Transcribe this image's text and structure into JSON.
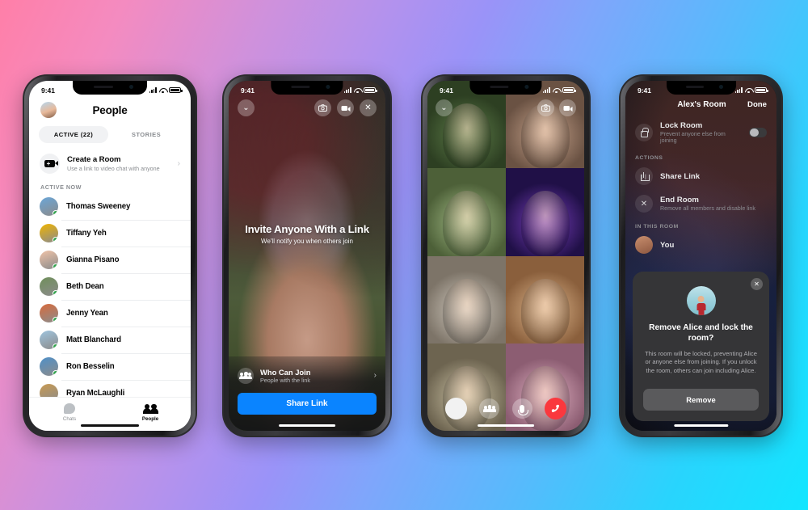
{
  "background": {
    "from": "#ff7fa8",
    "mid": "#9a93f8",
    "to": "#12e6ff"
  },
  "status_bar": {
    "time": "9:41"
  },
  "phone1": {
    "title": "People",
    "tabs": [
      {
        "label": "ACTIVE (22)",
        "active": true
      },
      {
        "label": "STORIES",
        "active": false
      }
    ],
    "create_room": {
      "title": "Create a Room",
      "subtitle": "Use a link to video chat with anyone",
      "chevron": "›"
    },
    "section_label": "ACTIVE NOW",
    "contacts": [
      {
        "name": "Thomas Sweeney",
        "color": "#6aa6d8"
      },
      {
        "name": "Tiffany Yeh",
        "color": "#f0b400"
      },
      {
        "name": "Gianna Pisano",
        "color": "#f0c3a8"
      },
      {
        "name": "Beth Dean",
        "color": "#6f8f5a"
      },
      {
        "name": "Jenny Yean",
        "color": "#d86a3c"
      },
      {
        "name": "Matt Blanchard",
        "color": "#9fc4de"
      },
      {
        "name": "Ron Besselin",
        "color": "#4f90c8"
      },
      {
        "name": "Ryan McLaughli",
        "color": "#c89a52"
      }
    ],
    "tabbar": [
      {
        "label": "Chats",
        "icon": "chat-bubble-icon",
        "active": false
      },
      {
        "label": "People",
        "icon": "people-icon",
        "active": true
      }
    ]
  },
  "phone2": {
    "controls": {
      "collapse": "chevron-down-icon",
      "flip_camera": "flip-camera-icon",
      "video": "video-camera-icon",
      "close": "✕"
    },
    "hero_title": "Invite Anyone With a Link",
    "hero_subtitle": "We'll notify you when others join",
    "who_can_join": {
      "title": "Who Can Join",
      "subtitle": "People with the link",
      "chevron": "›"
    },
    "share_button": "Share Link",
    "accent": "#0a84ff"
  },
  "phone3": {
    "controls": {
      "collapse": "chevron-down-icon",
      "flip_camera": "flip-camera-icon",
      "video": "video-camera-icon"
    },
    "call_controls": [
      {
        "name": "shutter-button",
        "icon": "shutter-icon"
      },
      {
        "name": "participants-button",
        "icon": "people-icon"
      },
      {
        "name": "mute-button",
        "icon": "microphone-icon"
      },
      {
        "name": "end-call-button",
        "icon": "phone-hangup-icon",
        "color": "#fa383e"
      }
    ],
    "tiles": [
      {
        "label": "participant-1",
        "bg_from": "#5f7f4a",
        "bg_to": "#2d3f22"
      },
      {
        "label": "participant-2",
        "bg_from": "#c8a48c",
        "bg_to": "#6a5243"
      },
      {
        "label": "participant-3",
        "bg_from": "#a7c08a",
        "bg_to": "#4d6038"
      },
      {
        "label": "participant-4",
        "bg_from": "#7b3fbf",
        "bg_to": "#201047"
      },
      {
        "label": "participant-5",
        "bg_from": "#d6cfc4",
        "bg_to": "#7d7468"
      },
      {
        "label": "participant-6",
        "bg_from": "#e0b98f",
        "bg_to": "#8a5f3c"
      },
      {
        "label": "participant-7",
        "bg_from": "#cfc6a8",
        "bg_to": "#6d6450"
      },
      {
        "label": "participant-8",
        "bg_from": "#e3b3c4",
        "bg_to": "#8c5d72"
      }
    ]
  },
  "phone4": {
    "title": "Alex's Room",
    "done": "Done",
    "lock_room": {
      "title": "Lock Room",
      "subtitle": "Prevent anyone else from joining",
      "enabled": false
    },
    "actions_label": "ACTIONS",
    "actions": [
      {
        "title": "Share Link",
        "subtitle": "",
        "icon": "share-icon"
      },
      {
        "title": "End Room",
        "subtitle": "Remove all members and disable link",
        "icon": "close-icon"
      }
    ],
    "in_room_label": "IN THIS ROOM",
    "members": [
      {
        "name": "You"
      }
    ],
    "modal": {
      "close": "✕",
      "title": "Remove Alice and lock the room?",
      "body": "This room will be locked, preventing Alice or anyone else from joining. If you unlock the room, others can join including Alice.",
      "button": "Remove"
    }
  }
}
